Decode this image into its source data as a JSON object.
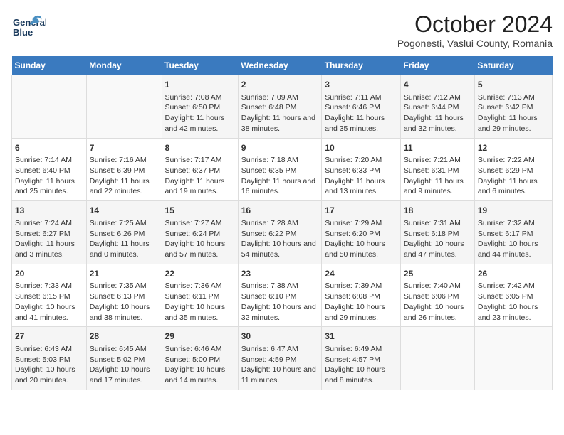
{
  "header": {
    "logo_line1": "General",
    "logo_line2": "Blue",
    "title": "October 2024",
    "subtitle": "Pogonesti, Vaslui County, Romania"
  },
  "days_of_week": [
    "Sunday",
    "Monday",
    "Tuesday",
    "Wednesday",
    "Thursday",
    "Friday",
    "Saturday"
  ],
  "weeks": [
    [
      {
        "day": "",
        "info": ""
      },
      {
        "day": "",
        "info": ""
      },
      {
        "day": "1",
        "info": "Sunrise: 7:08 AM\nSunset: 6:50 PM\nDaylight: 11 hours and 42 minutes."
      },
      {
        "day": "2",
        "info": "Sunrise: 7:09 AM\nSunset: 6:48 PM\nDaylight: 11 hours and 38 minutes."
      },
      {
        "day": "3",
        "info": "Sunrise: 7:11 AM\nSunset: 6:46 PM\nDaylight: 11 hours and 35 minutes."
      },
      {
        "day": "4",
        "info": "Sunrise: 7:12 AM\nSunset: 6:44 PM\nDaylight: 11 hours and 32 minutes."
      },
      {
        "day": "5",
        "info": "Sunrise: 7:13 AM\nSunset: 6:42 PM\nDaylight: 11 hours and 29 minutes."
      }
    ],
    [
      {
        "day": "6",
        "info": "Sunrise: 7:14 AM\nSunset: 6:40 PM\nDaylight: 11 hours and 25 minutes."
      },
      {
        "day": "7",
        "info": "Sunrise: 7:16 AM\nSunset: 6:39 PM\nDaylight: 11 hours and 22 minutes."
      },
      {
        "day": "8",
        "info": "Sunrise: 7:17 AM\nSunset: 6:37 PM\nDaylight: 11 hours and 19 minutes."
      },
      {
        "day": "9",
        "info": "Sunrise: 7:18 AM\nSunset: 6:35 PM\nDaylight: 11 hours and 16 minutes."
      },
      {
        "day": "10",
        "info": "Sunrise: 7:20 AM\nSunset: 6:33 PM\nDaylight: 11 hours and 13 minutes."
      },
      {
        "day": "11",
        "info": "Sunrise: 7:21 AM\nSunset: 6:31 PM\nDaylight: 11 hours and 9 minutes."
      },
      {
        "day": "12",
        "info": "Sunrise: 7:22 AM\nSunset: 6:29 PM\nDaylight: 11 hours and 6 minutes."
      }
    ],
    [
      {
        "day": "13",
        "info": "Sunrise: 7:24 AM\nSunset: 6:27 PM\nDaylight: 11 hours and 3 minutes."
      },
      {
        "day": "14",
        "info": "Sunrise: 7:25 AM\nSunset: 6:26 PM\nDaylight: 11 hours and 0 minutes."
      },
      {
        "day": "15",
        "info": "Sunrise: 7:27 AM\nSunset: 6:24 PM\nDaylight: 10 hours and 57 minutes."
      },
      {
        "day": "16",
        "info": "Sunrise: 7:28 AM\nSunset: 6:22 PM\nDaylight: 10 hours and 54 minutes."
      },
      {
        "day": "17",
        "info": "Sunrise: 7:29 AM\nSunset: 6:20 PM\nDaylight: 10 hours and 50 minutes."
      },
      {
        "day": "18",
        "info": "Sunrise: 7:31 AM\nSunset: 6:18 PM\nDaylight: 10 hours and 47 minutes."
      },
      {
        "day": "19",
        "info": "Sunrise: 7:32 AM\nSunset: 6:17 PM\nDaylight: 10 hours and 44 minutes."
      }
    ],
    [
      {
        "day": "20",
        "info": "Sunrise: 7:33 AM\nSunset: 6:15 PM\nDaylight: 10 hours and 41 minutes."
      },
      {
        "day": "21",
        "info": "Sunrise: 7:35 AM\nSunset: 6:13 PM\nDaylight: 10 hours and 38 minutes."
      },
      {
        "day": "22",
        "info": "Sunrise: 7:36 AM\nSunset: 6:11 PM\nDaylight: 10 hours and 35 minutes."
      },
      {
        "day": "23",
        "info": "Sunrise: 7:38 AM\nSunset: 6:10 PM\nDaylight: 10 hours and 32 minutes."
      },
      {
        "day": "24",
        "info": "Sunrise: 7:39 AM\nSunset: 6:08 PM\nDaylight: 10 hours and 29 minutes."
      },
      {
        "day": "25",
        "info": "Sunrise: 7:40 AM\nSunset: 6:06 PM\nDaylight: 10 hours and 26 minutes."
      },
      {
        "day": "26",
        "info": "Sunrise: 7:42 AM\nSunset: 6:05 PM\nDaylight: 10 hours and 23 minutes."
      }
    ],
    [
      {
        "day": "27",
        "info": "Sunrise: 6:43 AM\nSunset: 5:03 PM\nDaylight: 10 hours and 20 minutes."
      },
      {
        "day": "28",
        "info": "Sunrise: 6:45 AM\nSunset: 5:02 PM\nDaylight: 10 hours and 17 minutes."
      },
      {
        "day": "29",
        "info": "Sunrise: 6:46 AM\nSunset: 5:00 PM\nDaylight: 10 hours and 14 minutes."
      },
      {
        "day": "30",
        "info": "Sunrise: 6:47 AM\nSunset: 4:59 PM\nDaylight: 10 hours and 11 minutes."
      },
      {
        "day": "31",
        "info": "Sunrise: 6:49 AM\nSunset: 4:57 PM\nDaylight: 10 hours and 8 minutes."
      },
      {
        "day": "",
        "info": ""
      },
      {
        "day": "",
        "info": ""
      }
    ]
  ]
}
